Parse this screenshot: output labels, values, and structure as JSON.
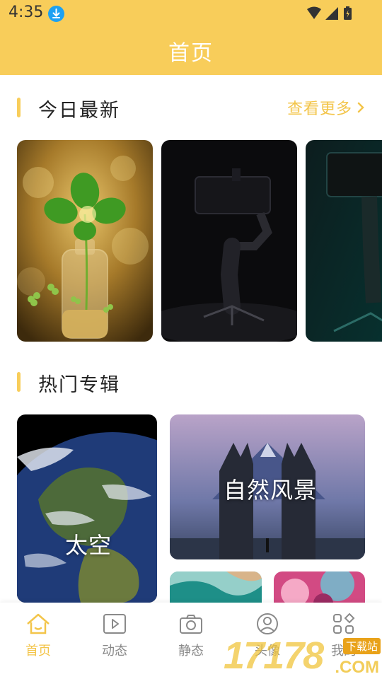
{
  "status_bar": {
    "time": "4:35"
  },
  "header": {
    "title": "首页"
  },
  "today_section": {
    "title": "今日最新",
    "more_label": "查看更多",
    "images": [
      "clover-bottle",
      "gimbal-dark",
      "gimbal-teal"
    ]
  },
  "hot_section": {
    "title": "热门专辑",
    "albums": [
      {
        "label": "太空"
      },
      {
        "label": "自然风景"
      },
      {
        "label": ""
      },
      {
        "label": ""
      }
    ]
  },
  "bottom_nav": {
    "items": [
      {
        "label": "首页",
        "icon": "home-icon",
        "active": true
      },
      {
        "label": "动态",
        "icon": "play-icon",
        "active": false
      },
      {
        "label": "静态",
        "icon": "camera-icon",
        "active": false
      },
      {
        "label": "头像",
        "icon": "avatar-icon",
        "active": false
      },
      {
        "label": "我的",
        "icon": "apps-icon",
        "active": false
      }
    ]
  },
  "watermark": {
    "text": "17178",
    "badge": "下载站",
    "domain": ".COM"
  },
  "colors": {
    "accent": "#f8cd5a",
    "more_text": "#f3c54a",
    "header_text": "#ffffff"
  }
}
